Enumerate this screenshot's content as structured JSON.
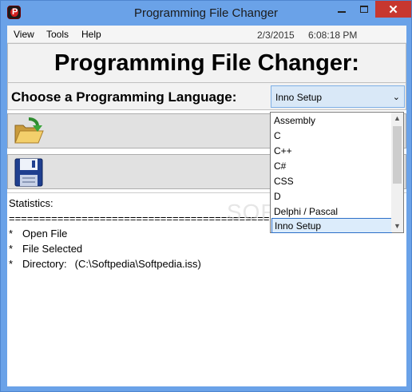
{
  "window": {
    "title": "Programming File Changer",
    "close_glyph": "✕",
    "colors": {
      "frame": "#6aa2e8",
      "close": "#c7372f",
      "selection": "#dcecfb"
    }
  },
  "menubar": {
    "items": [
      "View",
      "Tools",
      "Help"
    ],
    "date": "2/3/2015",
    "time": "6:08:18 PM"
  },
  "heading": "Programming File Changer:",
  "language": {
    "label": "Choose a Programming Language:",
    "selected": "Inno Setup",
    "arrow_glyph": "⌄",
    "options": [
      "Assembly",
      "C",
      "C++",
      "C#",
      "CSS",
      "D",
      "Delphi / Pascal",
      "Inno Setup"
    ]
  },
  "buttons": {
    "open_icon": "open-folder-icon",
    "save_icon": "floppy-disk-icon"
  },
  "statistics": {
    "label": "Statistics:",
    "separator": "============================================",
    "bullet": "*",
    "lines": [
      {
        "text": "Open File"
      },
      {
        "text": "File Selected"
      },
      {
        "text": "Directory:",
        "value": "(C:\\Softpedia\\Softpedia.iss)"
      }
    ]
  },
  "watermark": "SOFTPEDIA"
}
